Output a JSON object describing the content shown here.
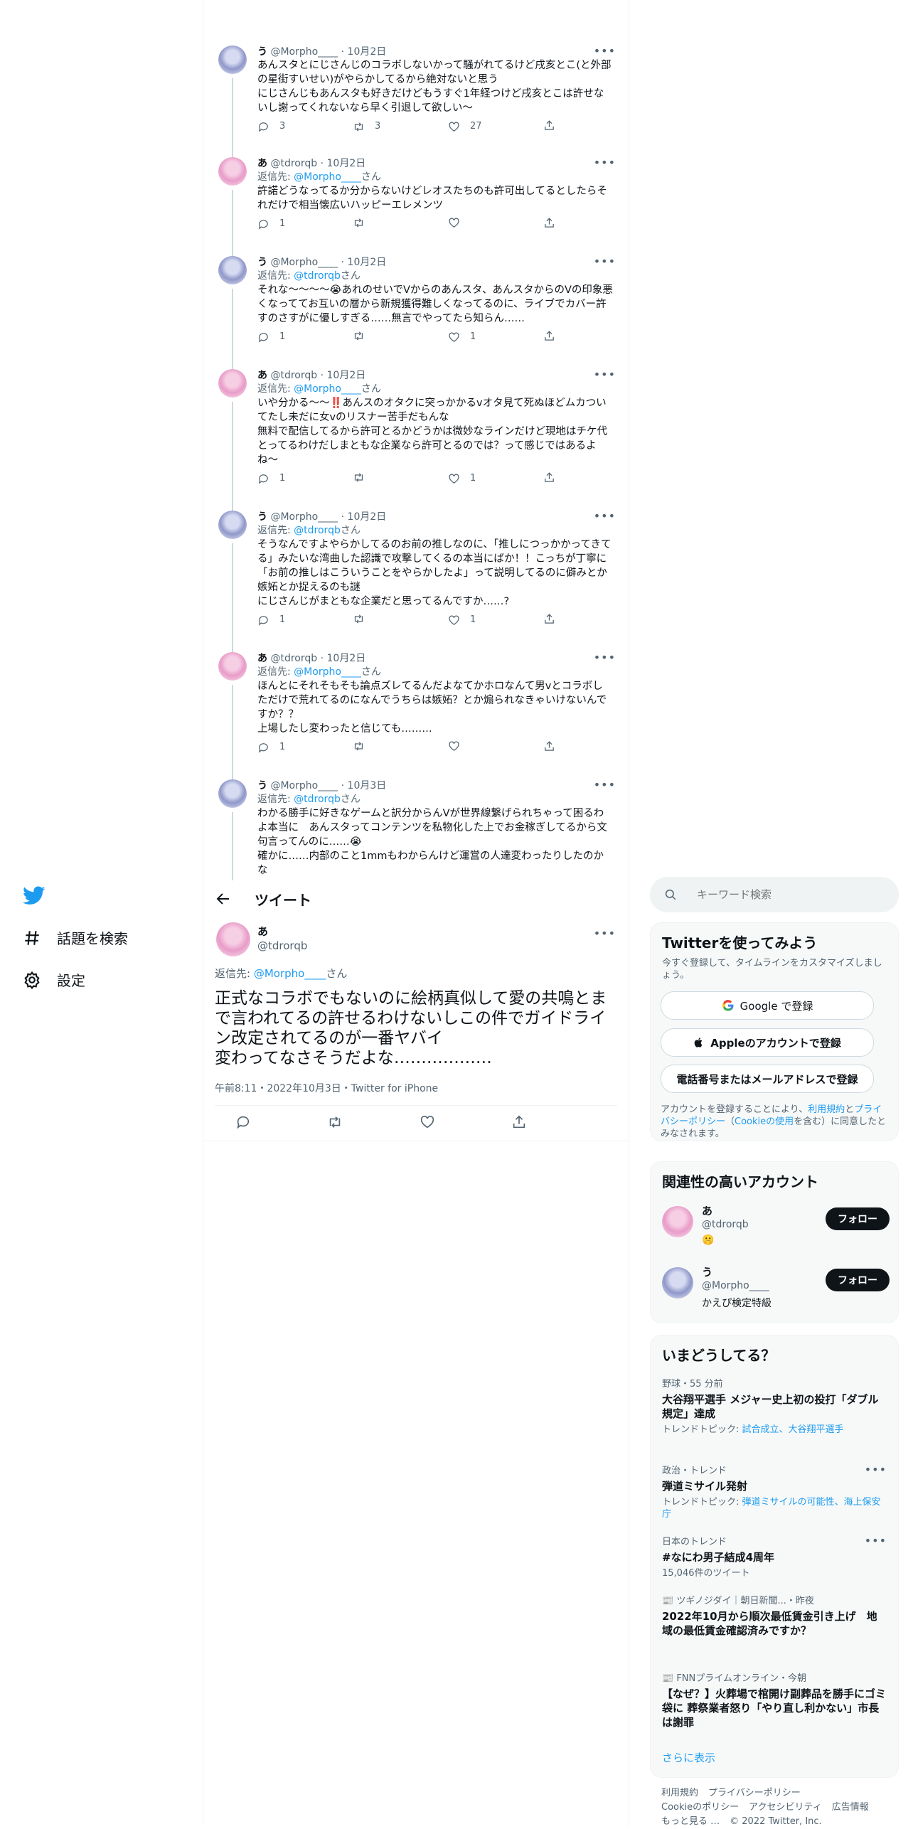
{
  "nav": {
    "explore_label": "話題を検索",
    "settings_label": "設定"
  },
  "thread": [
    {
      "name": "う",
      "handle": "@Morpho____",
      "date": "10月2日",
      "reply_prefix": "",
      "reply_to": "",
      "reply_suffix": "",
      "text": "あんスタとにじさんじのコラボしないかって騒がれてるけど戌亥とこ(と外部の星街すいせい)がやらかしてるから絶対ないと思う\nにじさんじもあんスタも好きだけどもうすぐ1年経つけど戌亥とこは許せないし謝ってくれないなら早く引退して欲しい～",
      "replies": "3",
      "retweets": "3",
      "likes": "27"
    },
    {
      "name": "あ",
      "handle": "@tdrorqb",
      "date": "10月2日",
      "reply_prefix": "返信先: ",
      "reply_to": "@Morpho____",
      "reply_suffix": "さん",
      "text": "許諾どうなってるか分からないけどレオスたちのも許可出してるとしたらそれだけで相当懐広いハッピーエレメンツ",
      "replies": "1",
      "retweets": "",
      "likes": ""
    },
    {
      "name": "う",
      "handle": "@Morpho____",
      "date": "10月2日",
      "reply_prefix": "返信先: ",
      "reply_to": "@tdrorqb",
      "reply_suffix": "さん",
      "text": "それな～～～～😭あれのせいでVからのあんスタ、あんスタからのVの印象悪くなっててお互いの層から新規獲得難しくなってるのに、ライブでカバー許すのさすがに優しすぎる……無言でやってたら知らん……",
      "replies": "1",
      "retweets": "",
      "likes": "1"
    },
    {
      "name": "あ",
      "handle": "@tdrorqb",
      "date": "10月2日",
      "reply_prefix": "返信先: ",
      "reply_to": "@Morpho____",
      "reply_suffix": "さん",
      "text": "いや分かる〜〜‼️あんスのオタクに突っかかるvオタ見て死ぬほどムカついてたし未だに女vのリスナー苦手だもんな\n無料で配信してるから許可とるかどうかは微妙なラインだけど現地はチケ代とってるわけだしまともな企業なら許可とるのでは？って感じではあるよね〜",
      "replies": "1",
      "retweets": "",
      "likes": "1"
    },
    {
      "name": "う",
      "handle": "@Morpho____",
      "date": "10月2日",
      "reply_prefix": "返信先: ",
      "reply_to": "@tdrorqb",
      "reply_suffix": "さん",
      "text": "そうなんですよやらかしてるのお前の推しなのに、「推しにつっかかってきてる」みたいな湾曲した認識で攻撃してくるの本当にばか！！こっちが丁寧に「お前の推しはこういうことをやらかしたよ」って説明してるのに僻みとか嫉妬とか捉えるのも謎\nにじさんじがまともな企業だと思ってるんですか……?",
      "replies": "1",
      "retweets": "",
      "likes": "1"
    },
    {
      "name": "あ",
      "handle": "@tdrorqb",
      "date": "10月2日",
      "reply_prefix": "返信先: ",
      "reply_to": "@Morpho____",
      "reply_suffix": "さん",
      "text": "ほんとにそれそもそも論点ズレてるんだよなてかホロなんて男vとコラボしただけで荒れてるのになんでうちらは嫉妬？とか煽られなきゃいけないんですか？？\n上場したし変わったと信じても………",
      "replies": "1",
      "retweets": "",
      "likes": ""
    },
    {
      "name": "う",
      "handle": "@Morpho____",
      "date": "10月3日",
      "reply_prefix": "返信先: ",
      "reply_to": "@tdrorqb",
      "reply_suffix": "さん",
      "text": "わかる勝手に好きなゲームと訳分からんVが世界線繋げられちゃって困るわよ本当に　あんスタってコンテンツを私物化した上でお金稼ぎしてるから文句言ってんのに……😭\n確かに……内部のこと1mmもわからんけど運営の人達変わったりしたのかな",
      "replies": "",
      "retweets": "",
      "likes": ""
    }
  ],
  "header": {
    "title": "ツイート"
  },
  "main_tweet": {
    "name": "あ",
    "handle": "@tdrorqb",
    "reply_prefix": "返信先: ",
    "reply_to": "@Morpho____",
    "reply_suffix": "さん",
    "text": "正式なコラボでもないのに絵柄真似して愛の共鳴とまで言われてるの許せるわけないしこの件でガイドライン改定されてるのが一番ヤバイ\n変わってなさそうだよな………………",
    "meta": "午前8:11・2022年10月3日・Twitter for iPhone"
  },
  "search": {
    "placeholder": "キーワード検索"
  },
  "signup": {
    "title": "Twitterを使ってみよう",
    "subtitle": "今すぐ登録して、タイムラインをカスタマイズしましょう。",
    "google": "Google で登録",
    "apple": "Appleのアカウントで登録",
    "phone": "電話番号またはメールアドレスで登録",
    "terms_1": "アカウントを登録することにより、",
    "terms_link1": "利用規約",
    "terms_2": "と",
    "terms_link2": "プライバシーポリシー",
    "terms_3": "（",
    "terms_link3": "Cookieの使用",
    "terms_4": "を含む）に同意したとみなされます。"
  },
  "relevant": {
    "title": "関連性の高いアカウント",
    "accounts": [
      {
        "name": "あ",
        "handle": "@tdrorqb",
        "bio": "🤫",
        "button": "フォロー"
      },
      {
        "name": "う",
        "handle": "@Morpho____",
        "bio": "かえぴ検定特級",
        "button": "フォロー"
      }
    ]
  },
  "trends": {
    "title": "いまどうしてる？",
    "items": [
      {
        "cat": "野球・55 分前",
        "title": "大谷翔平選手 メジャー史上初の投打「ダブル規定」達成",
        "sub_label": "トレンドトピック: ",
        "sub_link": "試合成立、大谷翔平選手"
      },
      {
        "cat": "政治・トレンド",
        "title": "弾道ミサイル発射",
        "sub_label": "トレンドトピック: ",
        "sub_link": "弾道ミサイルの可能性、海上保安庁"
      },
      {
        "cat": "日本のトレンド",
        "title": "#なにわ男子結成4周年",
        "sub_label": "15,046件のツイート",
        "sub_link": ""
      },
      {
        "cat": "📰 ツギノジダイ｜朝日新聞...・昨夜",
        "title": "2022年10月から順次最低賃金引き上げ　地域の最低賃金確認済みですか？",
        "sub_label": "",
        "sub_link": ""
      },
      {
        "cat": "📰 FNNプライムオンライン・今朝",
        "title": "【なぜ？】火葬場で棺開け副葬品を勝手にゴミ袋に 葬祭業者怒り「やり直し利かない」市長は謝罪",
        "sub_label": "",
        "sub_link": ""
      }
    ],
    "show_more": "さらに表示"
  },
  "footer": {
    "l1": "利用規約",
    "l2": "プライバシーポリシー",
    "l3": "Cookieのポリシー",
    "l4": "アクセシビリティ",
    "l5": "広告情報",
    "l6": "もっと見る …",
    "copyright": "© 2022 Twitter, Inc."
  },
  "colors": {
    "accent": "#1d9bf0",
    "text": "#0f1419",
    "muted": "#536471",
    "button_dark": "#0f1419"
  },
  "icons": [
    "twitter-bird-icon",
    "hashtag-icon",
    "gear-icon",
    "reply-icon",
    "retweet-icon",
    "like-icon",
    "share-icon",
    "more-icon",
    "back-arrow-icon",
    "search-icon",
    "google-icon",
    "apple-icon",
    "verified-icon"
  ]
}
